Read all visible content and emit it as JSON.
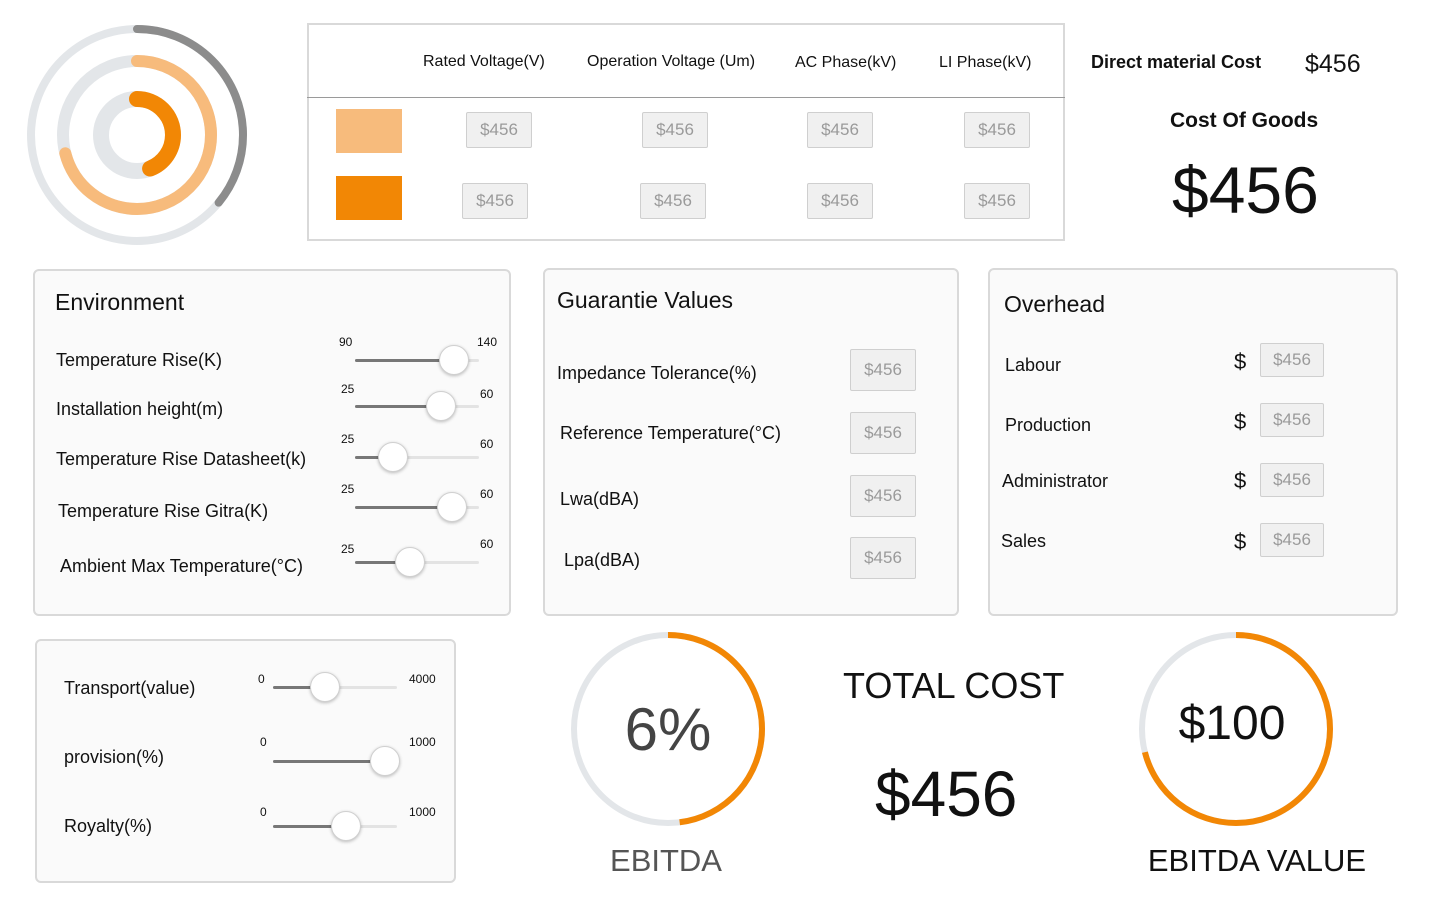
{
  "colors": {
    "accent": "#f28705",
    "accent_light": "#f7bb7c",
    "ring_grey": "#8c8c8c",
    "track": "#e3e6e9"
  },
  "rings": [
    {
      "name": "outer",
      "fraction": 0.36,
      "color": "#8c8c8c"
    },
    {
      "name": "middle",
      "fraction": 0.71,
      "color": "#f7bb7c"
    },
    {
      "name": "inner",
      "fraction": 0.44,
      "color": "#f28705"
    }
  ],
  "voltage_table": {
    "headers": [
      "Rated Voltage(V)",
      "Operation Voltage (Um)",
      "AC Phase(kV)",
      "LI Phase(kV)"
    ],
    "rows": [
      {
        "swatch": "#f7bb7c",
        "values": [
          "$456",
          "$456",
          "$456",
          "$456"
        ]
      },
      {
        "swatch": "#f28705",
        "values": [
          "$456",
          "$456",
          "$456",
          "$456"
        ]
      }
    ]
  },
  "direct_material": {
    "label": "Direct material Cost",
    "value": "$456"
  },
  "cost_of_goods": {
    "label": "Cost Of Goods",
    "value": "$456"
  },
  "environment": {
    "title": "Environment",
    "sliders": [
      {
        "label": "Temperature Rise(K)",
        "min": "90",
        "max": "140",
        "fraction": 0.8
      },
      {
        "label": "Installation height(m)",
        "min": "25",
        "max": "60",
        "fraction": 0.69
      },
      {
        "label": "Temperature Rise Datasheet(k)",
        "min": "25",
        "max": "60",
        "fraction": 0.31
      },
      {
        "label": "Temperature Rise Gitra(K)",
        "min": "25",
        "max": "60",
        "fraction": 0.78
      },
      {
        "label": "Ambient Max Temperature(°C)",
        "min": "25",
        "max": "60",
        "fraction": 0.44
      }
    ]
  },
  "guarantee": {
    "title": "Guarantie Values",
    "items": [
      {
        "label": "Impedance Tolerance(%)",
        "value": "$456"
      },
      {
        "label": "Reference Temperature(°C)",
        "value": "$456"
      },
      {
        "label": "Lwa(dBA)",
        "value": "$456"
      },
      {
        "label": "Lpa(dBA)",
        "value": "$456"
      }
    ]
  },
  "overhead": {
    "title": "Overhead",
    "currency": "$",
    "items": [
      {
        "label": "Labour",
        "value": "$456"
      },
      {
        "label": "Production",
        "value": "$456"
      },
      {
        "label": "Administrator",
        "value": "$456"
      },
      {
        "label": "Sales",
        "value": "$456"
      }
    ]
  },
  "costs_panel": {
    "sliders": [
      {
        "label": "Transport(value)",
        "min": "0",
        "max": "4000",
        "fraction": 0.42
      },
      {
        "label": "provision(%)",
        "min": "0",
        "max": "1000",
        "fraction": 0.9
      },
      {
        "label": "Royalty(%)",
        "min": "0",
        "max": "1000",
        "fraction": 0.59
      }
    ]
  },
  "ebitda": {
    "value": "6%",
    "label": "EBITDA",
    "fraction": 0.48
  },
  "total_cost": {
    "label": "TOTAL COST",
    "value": "$456"
  },
  "ebitda_value": {
    "value": "$100",
    "label": "EBITDA VALUE",
    "fraction": 0.71
  }
}
